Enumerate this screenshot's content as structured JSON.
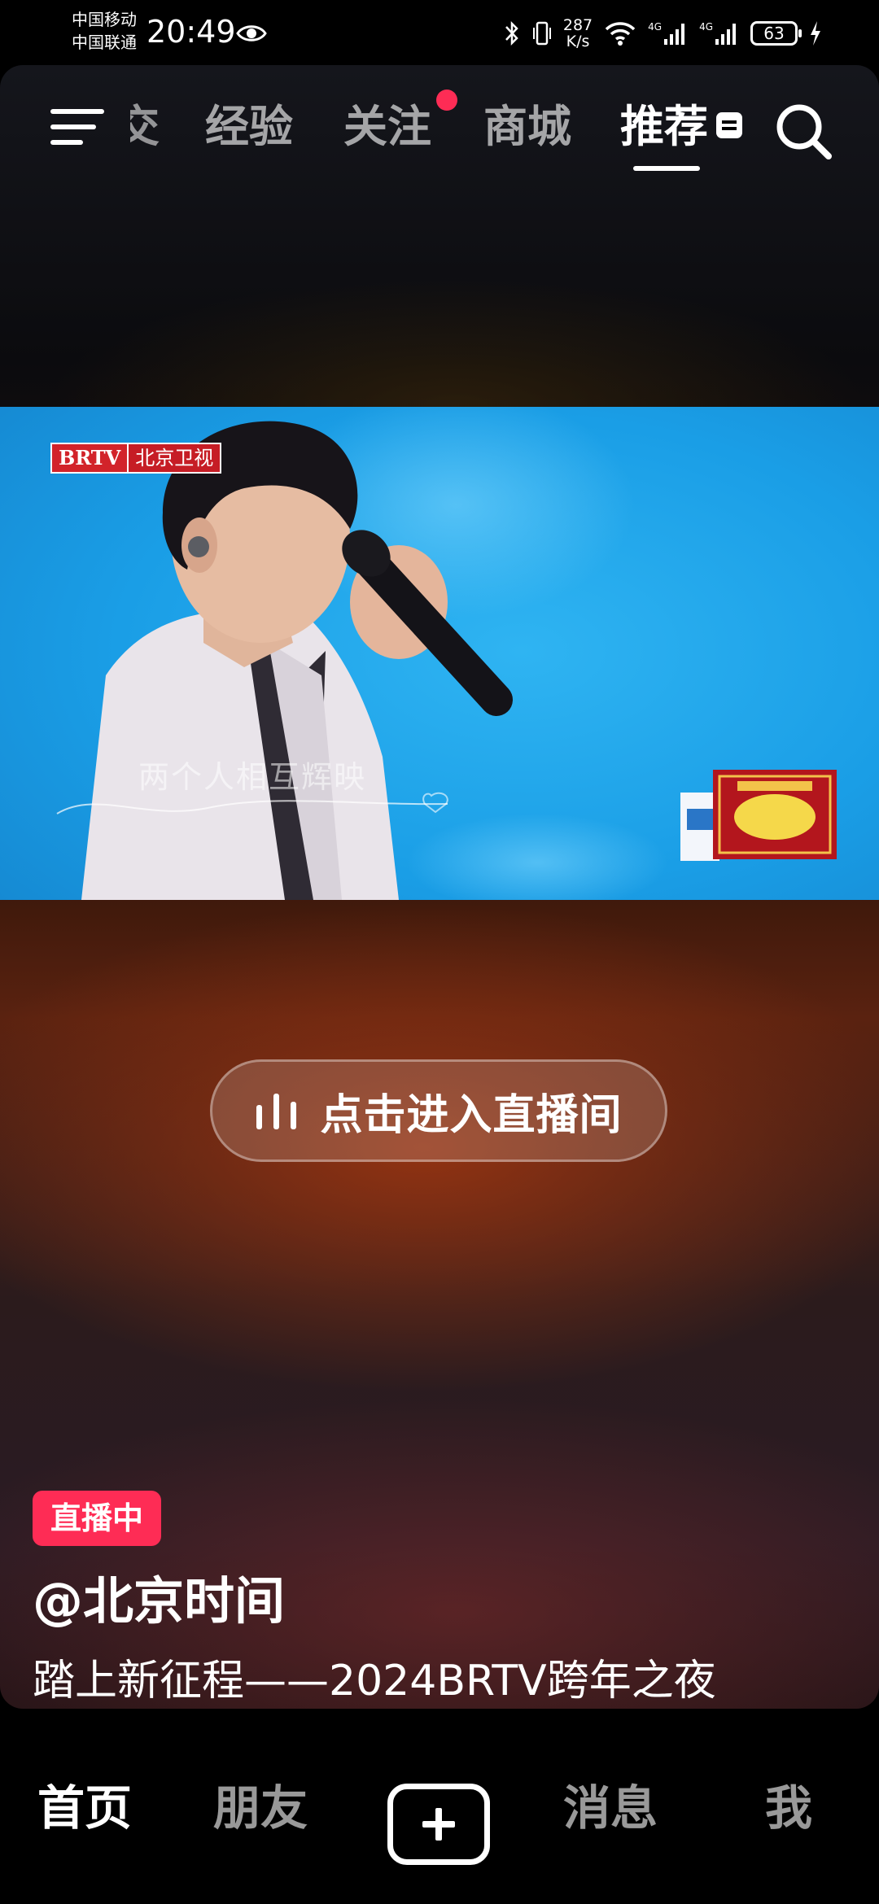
{
  "status_bar": {
    "carrier_1": "中国移动",
    "carrier_2": "中国联通",
    "time": "20:49",
    "net_speed_value": "287",
    "net_speed_unit": "K/s",
    "battery": "63",
    "network_1": "4G",
    "network_2": "4G"
  },
  "top_nav": {
    "partial_tab": "交",
    "tabs": [
      {
        "label": "经验"
      },
      {
        "label": "关注"
      },
      {
        "label": "商城"
      },
      {
        "label": "推荐"
      }
    ],
    "active_tab": "推荐"
  },
  "video": {
    "channel_logo_1": "BRTV",
    "channel_logo_2": "北京卫视",
    "lyric": "两个人相互辉映"
  },
  "enter_live": {
    "label": "点击进入直播间"
  },
  "post": {
    "live_badge": "直播中",
    "author": "@北京时间",
    "description": "踏上新征程——2024BRTV跨年之夜"
  },
  "bottom_nav": {
    "items": [
      {
        "label": "首页"
      },
      {
        "label": "朋友"
      },
      {
        "label": "消息"
      },
      {
        "label": "我"
      }
    ],
    "active": "首页"
  },
  "colors": {
    "live_badge": "#fe2c55",
    "notification_dot": "#fe2c55",
    "video_sky": "#1a9ee6"
  }
}
